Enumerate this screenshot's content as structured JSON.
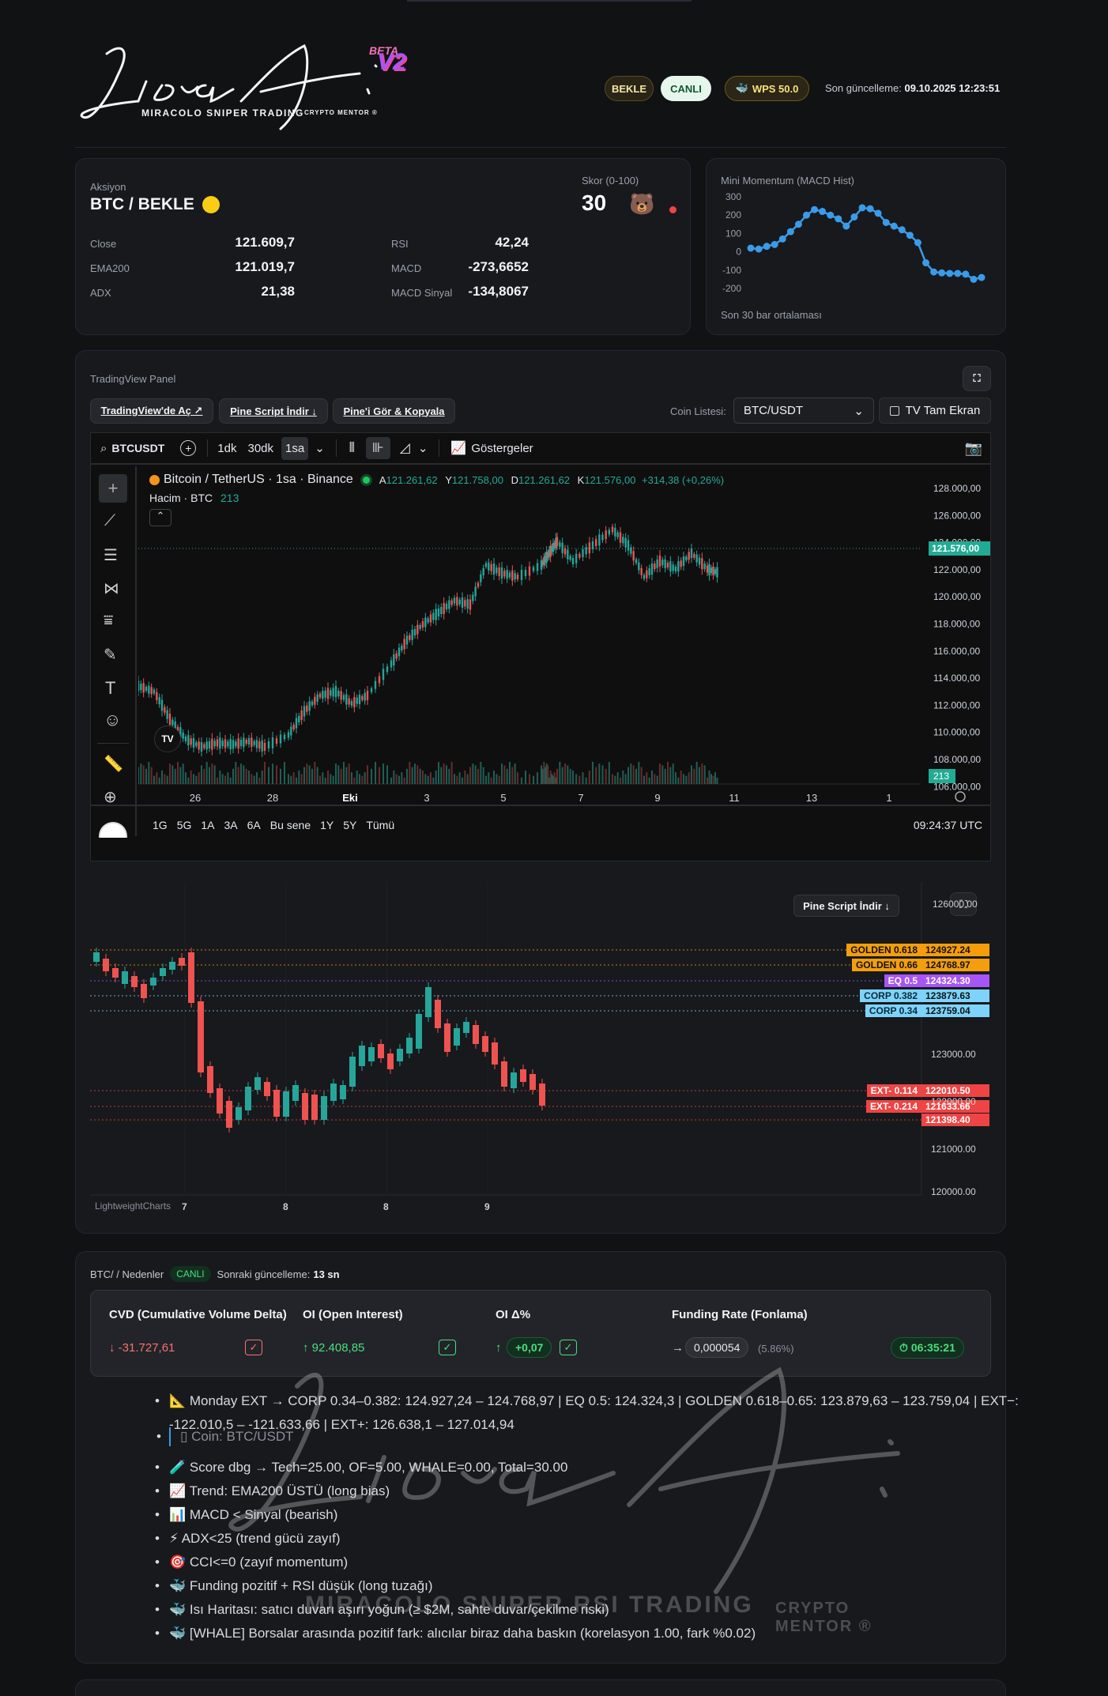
{
  "header": {
    "brand_script": "Lirra A.i",
    "brand_tagline": "MIRACOLO SNIPER TRADING",
    "brand_sub": "CRYPTO MENTOR ®",
    "beta_label": "BETA",
    "version_label": "V2",
    "status_wait": "BEKLE",
    "status_live": "CANLI",
    "wps_label": "WPS 50.0",
    "last_update_prefix": "Son güncelleme:",
    "last_update_value": "09.10.2025 12:23:51"
  },
  "signal_card": {
    "action_label": "Aksiyon",
    "action_value": "BTC / BEKLE",
    "score_label": "Skor (0-100)",
    "score_value": "30",
    "rows": [
      {
        "label": "Close",
        "value": "121.609,7",
        "label2": "RSI",
        "value2": "42,24"
      },
      {
        "label": "EMA200",
        "value": "121.019,7",
        "label2": "MACD",
        "value2": "-273,6652"
      },
      {
        "label": "ADX",
        "value": "21,38",
        "label2": "MACD Sinyal",
        "value2": "-134,8067"
      }
    ]
  },
  "momentum_card": {
    "title": "Mini Momentum (MACD Hist)",
    "footer": "Son 30 bar ortalaması",
    "y_ticks": [
      "300",
      "200",
      "100",
      "0",
      "-100",
      "-200"
    ],
    "color": "#3a9be8"
  },
  "chart_data": {
    "type": "line",
    "title": "Mini Momentum (MACD Hist)",
    "ylim": [
      -200,
      300
    ],
    "x": [
      1,
      2,
      3,
      4,
      5,
      6,
      7,
      8,
      9,
      10,
      11,
      12,
      13,
      14,
      15,
      16,
      17,
      18,
      19,
      20,
      21,
      22,
      23,
      24,
      25,
      26,
      27,
      28,
      29,
      30
    ],
    "series": [
      {
        "values": [
          20,
          15,
          30,
          40,
          70,
          110,
          150,
          200,
          230,
          220,
          200,
          180,
          140,
          190,
          240,
          235,
          210,
          160,
          140,
          120,
          90,
          50,
          -60,
          -110,
          -115,
          -118,
          -118,
          -122,
          -150,
          -140
        ]
      }
    ]
  },
  "tv_panel": {
    "title": "TradingView Panel",
    "btn_open": "TradingView'de Aç ↗",
    "btn_download": "Pine Script İndir ↓",
    "btn_copy": "Pine'i Gör & Kopyala",
    "coin_list_label": "Coin Listesi:",
    "coin_selected": "BTC/USDT",
    "fullscreen_label": "TV Tam Ekran",
    "toolbar": {
      "symbol": "BTCUSDT",
      "tf1": "1dk",
      "tf2": "30dk",
      "tf3": "1sa",
      "indicators": "Göstergeler"
    },
    "legend": {
      "name": "Bitcoin / TetherUS · 1sa · Binance",
      "o_label": "A",
      "o": "121.261,62",
      "h_label": "Y",
      "h": "121.758,00",
      "l_label": "D",
      "l": "121.261,62",
      "c_label": "K",
      "c": "121.576,00",
      "chg": "+314,38 (+0,26%)"
    },
    "volume_label": "Hacim · BTC",
    "volume_value": "213",
    "price_tag": "121.576,00",
    "vol_tag": "213",
    "y_ticks": [
      "128.000,00",
      "126.000,00",
      "124.000,00",
      "122.000,00",
      "120.000,00",
      "118.000,00",
      "116.000,00",
      "114.000,00",
      "112.000,00",
      "110.000,00",
      "108.000,00",
      "106.000,00"
    ],
    "x_ticks": [
      "26",
      "28",
      "Eki",
      "3",
      "5",
      "7",
      "9",
      "11",
      "13",
      "1"
    ],
    "ranges": [
      "1G",
      "5G",
      "1A",
      "3A",
      "6A",
      "Bu sene",
      "1Y",
      "5Y",
      "Tümü"
    ],
    "clock": "09:24:37 UTC"
  },
  "lw_chart": {
    "pine_btn": "Pine Script İndir ↓",
    "top_tick": "126000.00",
    "y_ticks": [
      "123000.00",
      "122000.00",
      "121000.00",
      "120000.00"
    ],
    "x_ticks": [
      "7",
      "8",
      "8",
      "9"
    ],
    "watermark": "LightweightCharts",
    "levels": [
      {
        "name": "GOLDEN 0.618",
        "price": "124927.24",
        "color": "#f59e0b"
      },
      {
        "name": "GOLDEN 0.66",
        "price": "124768.97",
        "color": "#f59e0b"
      },
      {
        "name": "EQ 0.5",
        "price": "124324.30",
        "color": "#a855f7"
      },
      {
        "name": "CORP 0.382",
        "price": "123879.63",
        "color": "#7dd3fc"
      },
      {
        "name": "CORP 0.34",
        "price": "123759.04",
        "color": "#7dd3fc"
      },
      {
        "name": "EXT- 0.114",
        "price": "122010.50",
        "color": "#ef4444"
      },
      {
        "name": "EXT- 0.214",
        "price": "121633.66",
        "color": "#ef4444"
      },
      {
        "name": "",
        "price": "121398.40",
        "color": "#ef4444"
      }
    ]
  },
  "reasons": {
    "title": "BTC/ / Nedenler",
    "live": "CANLI",
    "next_update_prefix": "Sonraki güncelleme:",
    "next_update_value": "13 sn",
    "metrics": [
      {
        "title": "CVD (Cumulative Volume Delta)",
        "value": "↓ -31.727,61"
      },
      {
        "title": "OI (Open Interest)",
        "value": "↑ 92.408,85"
      },
      {
        "title": "OI Δ%",
        "arrow": "↑",
        "value": "+0,07"
      },
      {
        "title": "Funding Rate (Fonlama)",
        "arrow": "→",
        "value": "0,000054",
        "pct": "(5.86%)",
        "timer": "06:35:21"
      }
    ],
    "items": [
      "📐 Monday EXT → CORP 0.34–0.382: 124.927,24 – 124.768,97 | EQ 0.5: 124.324,3 | GOLDEN 0.618–0.65: 123.879,63 – 123.759,04 | EXT−: -122.010,5 – -121.633,66 | EXT+: 126.638,1 – 127.014,94",
      "▯ Coin: BTC/USDT",
      "🧪 Score dbg → Tech=25.00, OF=5.00, WHALE=0.00, Total=30.00",
      "📈 Trend: EMA200 ÜSTÜ (long bias)",
      "📊 MACD < Sinyal (bearish)",
      "⚡ ADX<25 (trend gücü zayıf)",
      "🎯 CCI<=0 (zayıf momentum)",
      "🐳 Funding pozitif + RSI düşük (long tuzağı)",
      "🐳 Isı Haritası: satıcı duvarı aşırı yoğun (≥ $2M, sahte duvar/çekilme riski)",
      "🐳 [WHALE] Borsalar arasında pozitif fark: alıcılar biraz daha baskın (korelasyon 1.00, fark %0.02)"
    ]
  },
  "watermark": {
    "script": "Lirra A.i",
    "tagline": "MIRACOLO SNIPER RSI TRADING",
    "sub": "CRYPTO MENTOR ®"
  }
}
